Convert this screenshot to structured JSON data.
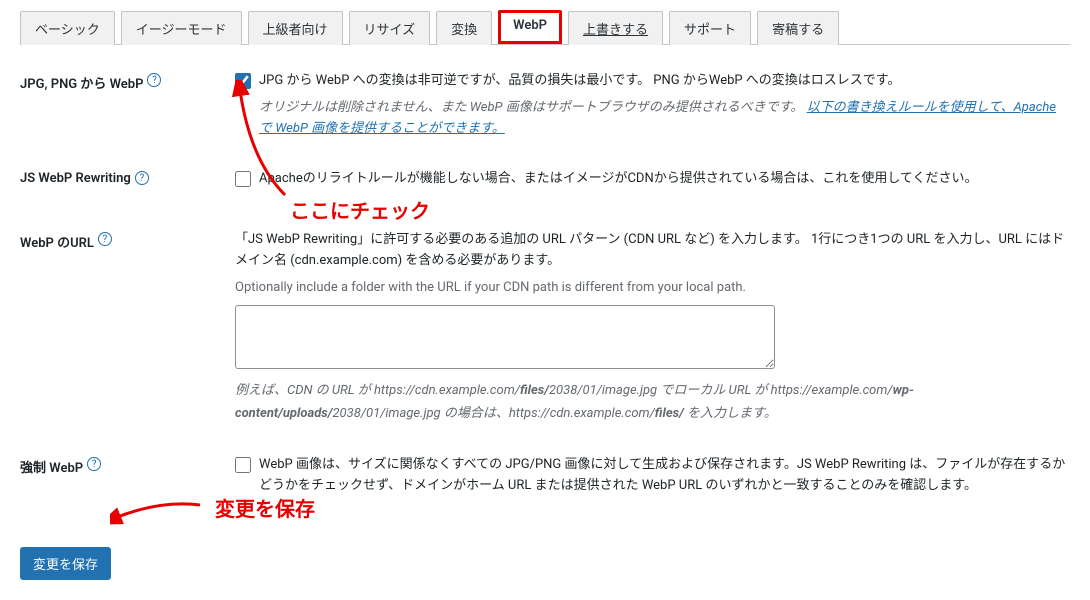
{
  "tabs": [
    {
      "label": "ベーシック"
    },
    {
      "label": "イージーモード"
    },
    {
      "label": "上級者向け"
    },
    {
      "label": "リサイズ"
    },
    {
      "label": "変換"
    },
    {
      "label": "WebP",
      "active": true
    },
    {
      "label": "上書きする",
      "link": true
    },
    {
      "label": "サポート"
    },
    {
      "label": "寄稿する"
    }
  ],
  "rows": {
    "jpgpng": {
      "label": "JPG, PNG から WebP",
      "cb_text": "JPG から WebP への変換は非可逆ですが、品質の損失は最小です。 PNG からWebP への変換はロスレスです。",
      "desc_prefix": "オリジナルは削除されません、また WebP 画像はサポートブラウザのみ提供されるべきです。",
      "desc_link": "以下の書き換えルールを使用して、Apache で WebP 画像を提供することができます。",
      "checked": true
    },
    "jswebp": {
      "label": "JS WebP Rewriting",
      "cb_text": "Apacheのリライトルールが機能しない場合、またはイメージがCDNから提供されている場合は、これを使用してください。",
      "checked": false
    },
    "webpurl": {
      "label": "WebP のURL",
      "desc1": "「JS WebP Rewriting」に許可する必要のある追加の URL パターン (CDN URL など) を入力します。 1行につき1つの URL を入力し、URL にはドメイン名 (cdn.example.com) を含める必要があります。",
      "desc2": "Optionally include a folder with the URL if your CDN path is different from your local path.",
      "textarea_value": "",
      "example_p1": "例えば、CDN の URL が https://cdn.example.com/",
      "example_b1": "files/",
      "example_p2": "2038/01/image.jpg でローカル URL が https://example.com/",
      "example_b2": "wp-content/uploads/",
      "example_p3": "2038/01/image.jpg の場合は、https://cdn.example.com/",
      "example_b3": "files/",
      "example_p4": " を入力します。"
    },
    "forcewebp": {
      "label": "強制 WebP",
      "cb_text": "WebP 画像は、サイズに関係なくすべての JPG/PNG 画像に対して生成および保存されます。JS WebP Rewriting は、ファイルが存在するかどうかをチェックせず、ドメインがホーム URL または提供された WebP URL のいずれかと一致することのみを確認します。",
      "checked": false
    }
  },
  "save_button": "変更を保存",
  "annotations": {
    "check_here": "ここにチェック",
    "save_here": "変更を保存"
  }
}
